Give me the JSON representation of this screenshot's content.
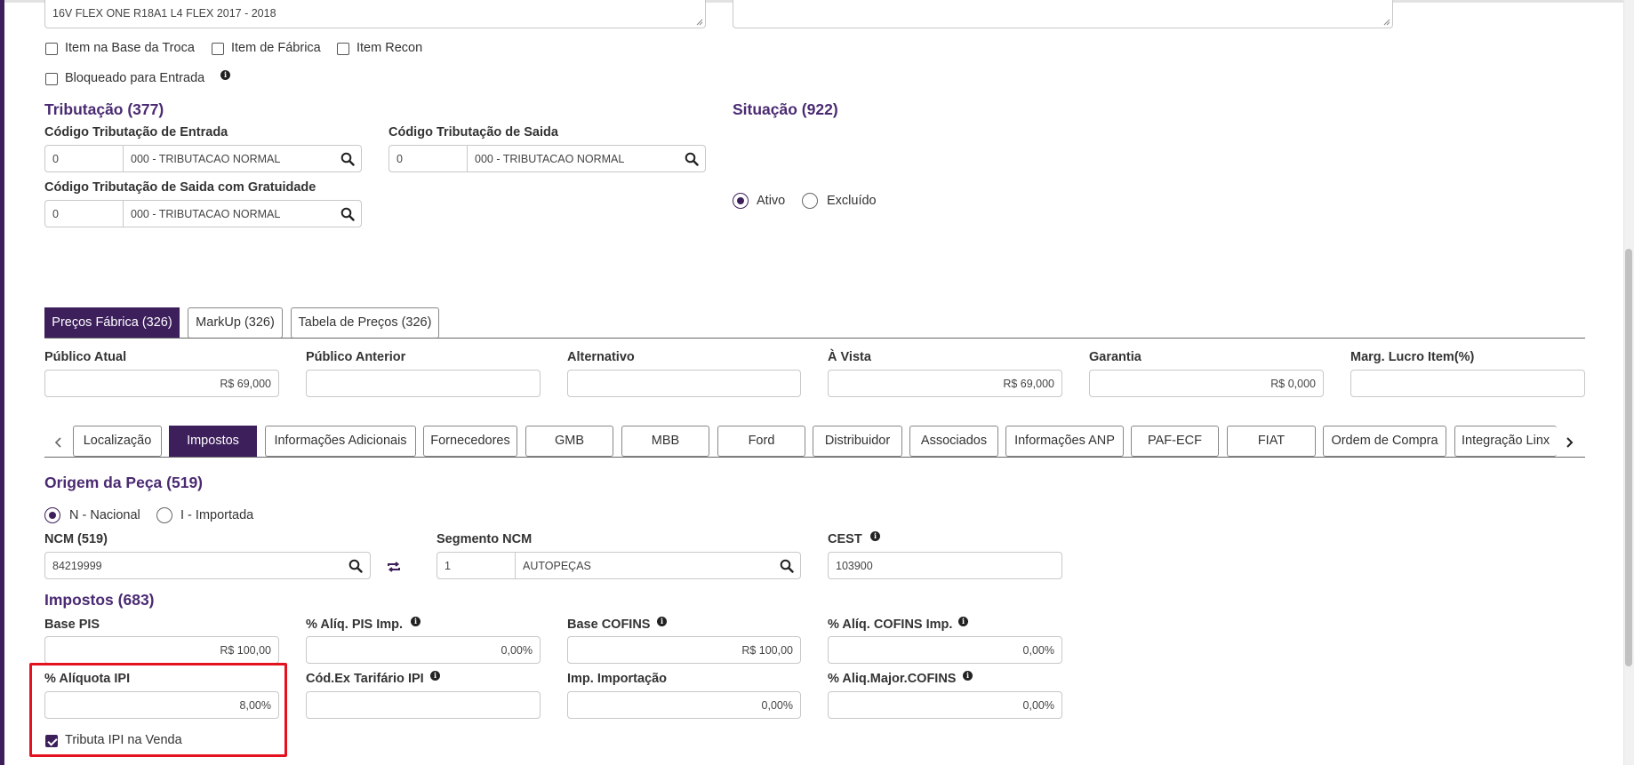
{
  "description_text": "16V FLEX ONE R18A1 L4 FLEX 2017 - 2018",
  "checkboxes": {
    "item_base_troca": "Item na Base da Troca",
    "item_fabrica": "Item de Fábrica",
    "item_recon": "Item Recon",
    "bloqueado_entrada": "Bloqueado para Entrada"
  },
  "tributacao": {
    "title": "Tributação (377)",
    "entrada_label": "Código Tributação de Entrada",
    "entrada_code": "0",
    "entrada_desc": "000 - TRIBUTACAO NORMAL",
    "saida_label": "Código Tributação de Saida",
    "saida_code": "0",
    "saida_desc": "000 - TRIBUTACAO NORMAL",
    "gratuidade_label": "Código Tributação de Saida com Gratuidade",
    "gratuidade_code": "0",
    "gratuidade_desc": "000 - TRIBUTACAO NORMAL"
  },
  "situacao": {
    "title": "Situação (922)",
    "ativo": "Ativo",
    "excluido": "Excluído",
    "selected": "Ativo"
  },
  "price_tabs": [
    "Preços Fábrica (326)",
    "MarkUp (326)",
    "Tabela de Preços (326)"
  ],
  "prices": {
    "publico_atual_label": "Público Atual",
    "publico_atual": "R$ 69,000",
    "publico_anterior_label": "Público Anterior",
    "publico_anterior": "",
    "alternativo_label": "Alternativo",
    "alternativo": "",
    "a_vista_label": "À Vista",
    "a_vista": "R$ 69,000",
    "garantia_label": "Garantia",
    "garantia": "R$ 0,000",
    "marg_lucro_label": "Marg. Lucro Item(%)",
    "marg_lucro": ""
  },
  "detail_tabs": [
    "Localização",
    "Impostos",
    "Informações Adicionais",
    "Fornecedores",
    "GMB",
    "MBB",
    "Ford",
    "Distribuidor",
    "Associados",
    "Informações ANP",
    "PAF-ECF",
    "FIAT",
    "Ordem de Compra",
    "Integração Linx"
  ],
  "active_detail_tab": "Impostos",
  "origem": {
    "title": "Origem da Peça (519)",
    "nacional": "N - Nacional",
    "importada": "I - Importada",
    "selected": "N - Nacional"
  },
  "ncm": {
    "label": "NCM (519)",
    "value": "84219999",
    "segmento_label": "Segmento NCM",
    "segmento_code": "1",
    "segmento_desc": "AUTOPEÇAS",
    "cest_label": "CEST",
    "cest_value": "103900"
  },
  "impostos": {
    "title": "Impostos (683)",
    "base_pis_label": "Base PIS",
    "base_pis": "R$ 100,00",
    "aliq_pis_label": "% Alíq. PIS Imp.",
    "aliq_pis": "0,00%",
    "base_cofins_label": "Base COFINS",
    "base_cofins": "R$ 100,00",
    "aliq_cofins_label": "% Alíq. COFINS Imp.",
    "aliq_cofins": "0,00%",
    "aliq_ipi_label": "% Alíquota IPI",
    "aliq_ipi": "8,00%",
    "cod_ex_label": "Cód.Ex Tarifário IPI",
    "cod_ex": "",
    "imp_importacao_label": "Imp. Importação",
    "imp_importacao": "0,00%",
    "aliq_major_label": "% Aliq.Major.COFINS",
    "aliq_major": "0,00%",
    "tributa_ipi_label": "Tributa IPI na Venda",
    "tributa_ipi_checked": true
  },
  "colors": {
    "primary": "#3d1f5c",
    "heading": "#4a2a72",
    "highlight": "#e3121e"
  }
}
